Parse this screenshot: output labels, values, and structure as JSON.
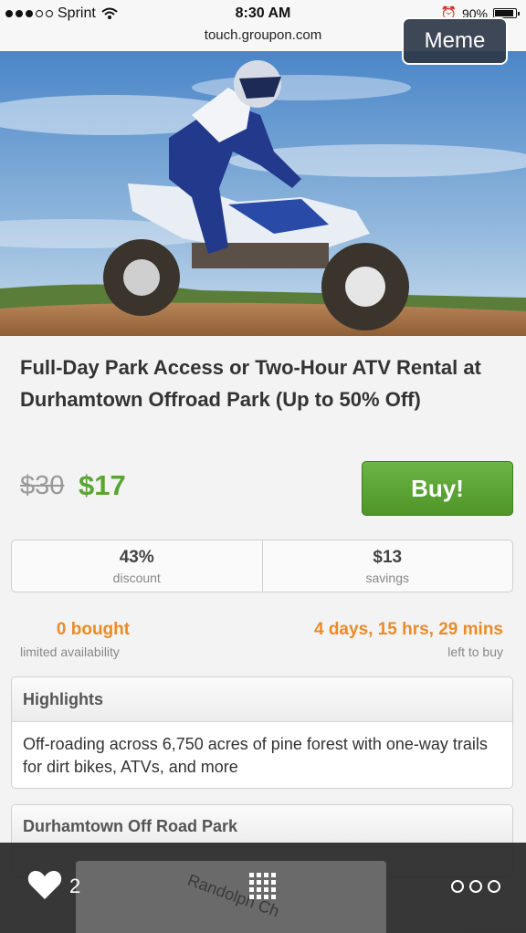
{
  "status_bar": {
    "carrier": "Sprint",
    "time": "8:30 AM",
    "url": "touch.groupon.com",
    "battery": "90%"
  },
  "meme_label": "Meme",
  "deal": {
    "title": "Full-Day Park Access or Two-Hour ATV Rental at Durhamtown Offroad Park (Up to 50% Off)",
    "original_price": "$30",
    "price": "$17",
    "buy_label": "Buy!"
  },
  "stats": {
    "discount_value": "43%",
    "discount_label": "discount",
    "savings_value": "$13",
    "savings_label": "savings"
  },
  "availability": {
    "bought_value": "0 bought",
    "bought_label": "limited availability",
    "time_value": "4 days, 15 hrs, 29 mins",
    "time_label": "left to buy"
  },
  "highlights": {
    "header": "Highlights",
    "text": "Off-roading across 6,750 acres of pine forest with one-way trails for dirt bikes, ATVs, and more"
  },
  "location": {
    "header": "Durhamtown Off Road Park",
    "map_street": "Randolph Ch"
  },
  "bottom_bar": {
    "like_count": "2"
  },
  "colors": {
    "price_green": "#5aa532",
    "accent_orange": "#e88c2a",
    "buy_green": "#5ea636"
  }
}
